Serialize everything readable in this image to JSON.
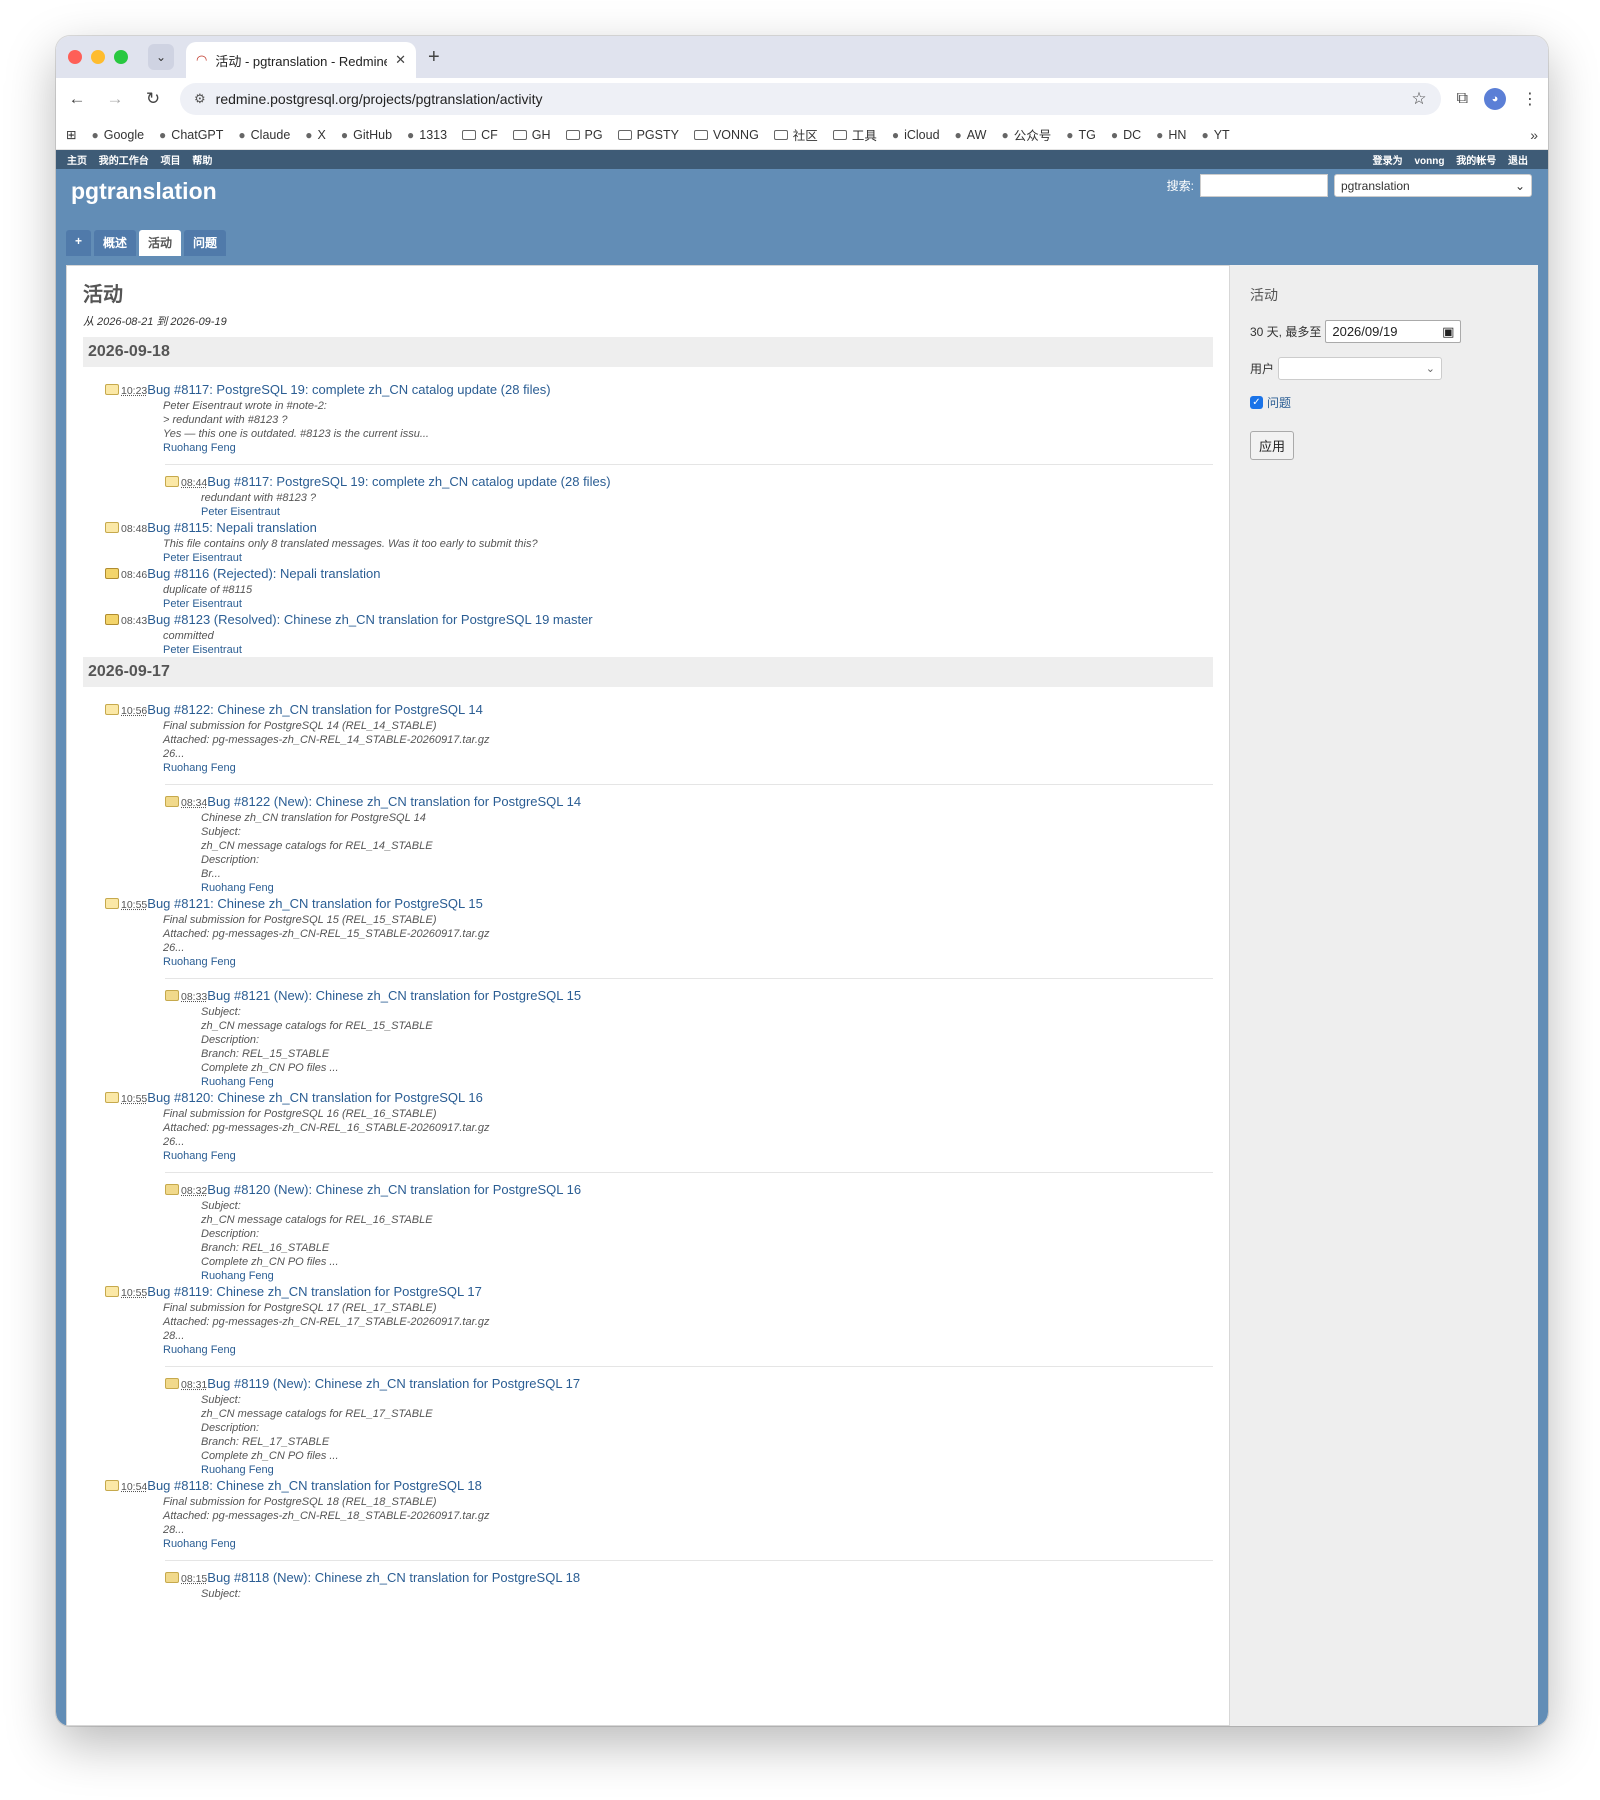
{
  "browser": {
    "tab_title": "活动 - pgtranslation - Redmine",
    "url": "redmine.postgresql.org/projects/pgtranslation/activity",
    "bookmarks": [
      "Google",
      "ChatGPT",
      "Claude",
      "X",
      "GitHub",
      "1313",
      "CF",
      "GH",
      "PG",
      "PGSTY",
      "VONNG",
      "社区",
      "工具",
      "iCloud",
      "AW",
      "公众号",
      "TG",
      "DC",
      "HN",
      "YT"
    ]
  },
  "topmenu": {
    "home": "主页",
    "mypage": "我的工作台",
    "projects": "项目",
    "help": "帮助",
    "logged_as": "登录为",
    "user": "vonng",
    "account": "我的帐号",
    "logout": "退出"
  },
  "header": {
    "project": "pgtranslation",
    "search_label": "搜索:",
    "project_select": "pgtranslation",
    "menu": {
      "new": "+",
      "overview": "概述",
      "activity": "活动",
      "issues": "问题"
    }
  },
  "content": {
    "title": "活动",
    "subtitle": "从 2026-08-21 到 2026-09-19",
    "days": [
      {
        "date": "2026-09-18",
        "entries": [
          {
            "time": "10:23",
            "link": "Bug #8117: PostgreSQL 19: complete zh_CN catalog update (28 files)",
            "desc": [
              "Peter Eisentraut wrote in #note-2:",
              "> redundant with #8123 ?",
              "Yes — this one is outdated. #8123 is the current issu..."
            ],
            "author": "Ruohang Feng",
            "child": {
              "time": "08:44",
              "link": "Bug #8117: PostgreSQL 19: complete zh_CN catalog update (28 files)",
              "desc": [
                "redundant with #8123 ?"
              ],
              "author": "Peter Eisentraut"
            }
          },
          {
            "time": "08:48",
            "link": "Bug #8115: Nepali translation",
            "desc": [
              "This file contains only 8 translated messages. Was it too early to submit this?"
            ],
            "author": "Peter Eisentraut"
          },
          {
            "time": "08:46",
            "link": "Bug #8116 (Rejected): Nepali translation",
            "desc": [
              "duplicate of #8115"
            ],
            "author": "Peter Eisentraut"
          },
          {
            "time": "08:43",
            "link": "Bug #8123 (Resolved): Chinese zh_CN translation for PostgreSQL 19 master",
            "desc": [
              "committed"
            ],
            "author": "Peter Eisentraut"
          }
        ]
      },
      {
        "date": "2026-09-17",
        "entries": [
          {
            "time": "10:56",
            "link": "Bug #8122: Chinese zh_CN translation for PostgreSQL 14",
            "desc": [
              "Final submission for PostgreSQL 14 (REL_14_STABLE)",
              "Attached: pg-messages-zh_CN-REL_14_STABLE-20260917.tar.gz",
              "26..."
            ],
            "author": "Ruohang Feng",
            "child": {
              "time": "08:34",
              "link": "Bug #8122 (New): Chinese zh_CN translation for PostgreSQL 14",
              "desc": [
                "Chinese zh_CN translation for PostgreSQL 14",
                "Subject:",
                "zh_CN message catalogs for REL_14_STABLE",
                "Description:",
                "Br..."
              ],
              "author": "Ruohang Feng"
            }
          },
          {
            "time": "10:55",
            "link": "Bug #8121: Chinese zh_CN translation for PostgreSQL 15",
            "desc": [
              "Final submission for PostgreSQL 15 (REL_15_STABLE)",
              "Attached: pg-messages-zh_CN-REL_15_STABLE-20260917.tar.gz",
              "26..."
            ],
            "author": "Ruohang Feng",
            "child": {
              "time": "08:33",
              "link": "Bug #8121 (New): Chinese zh_CN translation for PostgreSQL 15",
              "desc": [
                "Subject:",
                "zh_CN message catalogs for REL_15_STABLE",
                "Description:",
                "Branch: REL_15_STABLE",
                "Complete zh_CN PO files ..."
              ],
              "author": "Ruohang Feng"
            }
          },
          {
            "time": "10:55",
            "link": "Bug #8120: Chinese zh_CN translation for PostgreSQL 16",
            "desc": [
              "Final submission for PostgreSQL 16 (REL_16_STABLE)",
              "Attached: pg-messages-zh_CN-REL_16_STABLE-20260917.tar.gz",
              "26..."
            ],
            "author": "Ruohang Feng",
            "child": {
              "time": "08:32",
              "link": "Bug #8120 (New): Chinese zh_CN translation for PostgreSQL 16",
              "desc": [
                "Subject:",
                "zh_CN message catalogs for REL_16_STABLE",
                "Description:",
                "Branch: REL_16_STABLE",
                "Complete zh_CN PO files ..."
              ],
              "author": "Ruohang Feng"
            }
          },
          {
            "time": "10:55",
            "link": "Bug #8119: Chinese zh_CN translation for PostgreSQL 17",
            "desc": [
              "Final submission for PostgreSQL 17 (REL_17_STABLE)",
              "Attached: pg-messages-zh_CN-REL_17_STABLE-20260917.tar.gz",
              "28..."
            ],
            "author": "Ruohang Feng",
            "child": {
              "time": "08:31",
              "link": "Bug #8119 (New): Chinese zh_CN translation for PostgreSQL 17",
              "desc": [
                "Subject:",
                "zh_CN message catalogs for REL_17_STABLE",
                "Description:",
                "Branch: REL_17_STABLE",
                "Complete zh_CN PO files ..."
              ],
              "author": "Ruohang Feng"
            }
          },
          {
            "time": "10:54",
            "link": "Bug #8118: Chinese zh_CN translation for PostgreSQL 18",
            "desc": [
              "Final submission for PostgreSQL 18 (REL_18_STABLE)",
              "Attached: pg-messages-zh_CN-REL_18_STABLE-20260917.tar.gz",
              "28..."
            ],
            "author": "Ruohang Feng",
            "child": {
              "time": "08:15",
              "link": "Bug #8118 (New): Chinese zh_CN translation for PostgreSQL 18",
              "desc": [
                "Subject:"
              ],
              "author": ""
            }
          }
        ]
      }
    ]
  },
  "sidebar": {
    "heading": "活动",
    "days_label": "30 天, 最多至",
    "date_value": "2026/09/19",
    "user_label": "用户",
    "issues_label": "问题",
    "apply": "应用"
  },
  "colors": {
    "header": "#628db6",
    "topmenu": "#3e5b76",
    "link": "#2a5d93"
  }
}
